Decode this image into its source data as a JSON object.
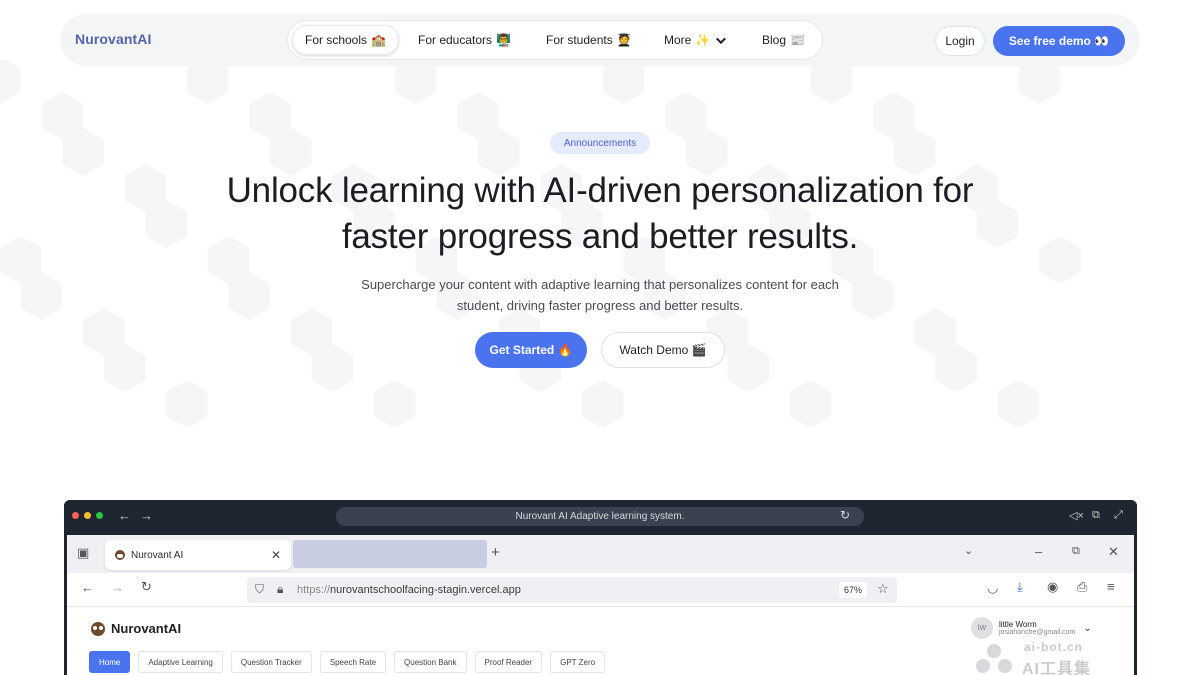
{
  "header": {
    "brand": "NurovantAI",
    "nav": [
      {
        "label": "For schools",
        "emoji": "🏫",
        "active": true
      },
      {
        "label": "For educators",
        "emoji": "👨‍🏫",
        "active": false
      },
      {
        "label": "For students",
        "emoji": "🧑‍🎓",
        "active": false
      },
      {
        "label": "More",
        "emoji": "✨",
        "active": false
      },
      {
        "label": "Blog",
        "emoji": "📰",
        "active": false
      }
    ],
    "login_label": "Login",
    "demo_label": "See free demo 👀"
  },
  "hero": {
    "badge": "Announcements",
    "title_line1": "Unlock learning with AI-driven personalization for",
    "title_line2": "faster progress and better results.",
    "subtitle_line1": "Supercharge your content with adaptive learning that personalizes content for each",
    "subtitle_line2": "student, driving faster progress and better results.",
    "primary_cta": "Get Started 🔥",
    "secondary_cta": "Watch Demo 🎬"
  },
  "preview": {
    "window_title": "Nurovant AI Adaptive learning system.",
    "tab_title": "Nurovant AI",
    "url_scheme": "https://",
    "url_host": "nurovantschoolfacing-stagin.vercel.app",
    "zoom": "67%",
    "app_name": "NurovantAI",
    "user_initials": "lW",
    "user_name": "little Worm",
    "user_email": "josiahonche@gmail.com",
    "app_tabs": [
      "Home",
      "Adaptive Learning",
      "Question Tracker",
      "Speech Rate",
      "Question Bank",
      "Proof Reader",
      "GPT Zero"
    ]
  },
  "watermark": {
    "line1": "ai-bot.cn",
    "line2": "AI工具集"
  },
  "colors": {
    "accent": "#4a73f0",
    "brand": "#5564a8",
    "frame": "#1e2530"
  }
}
